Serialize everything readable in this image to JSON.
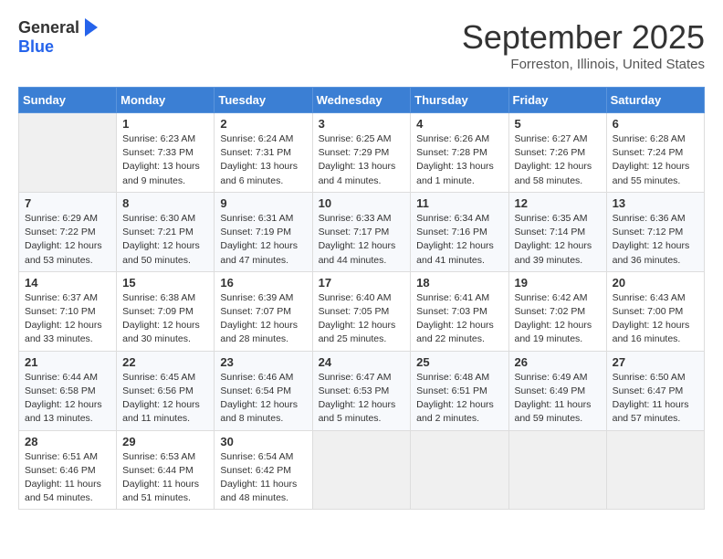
{
  "header": {
    "logo_general": "General",
    "logo_blue": "Blue",
    "month_title": "September 2025",
    "location": "Forreston, Illinois, United States"
  },
  "days_of_week": [
    "Sunday",
    "Monday",
    "Tuesday",
    "Wednesday",
    "Thursday",
    "Friday",
    "Saturday"
  ],
  "weeks": [
    [
      {
        "day": "",
        "info": ""
      },
      {
        "day": "1",
        "info": "Sunrise: 6:23 AM\nSunset: 7:33 PM\nDaylight: 13 hours\nand 9 minutes."
      },
      {
        "day": "2",
        "info": "Sunrise: 6:24 AM\nSunset: 7:31 PM\nDaylight: 13 hours\nand 6 minutes."
      },
      {
        "day": "3",
        "info": "Sunrise: 6:25 AM\nSunset: 7:29 PM\nDaylight: 13 hours\nand 4 minutes."
      },
      {
        "day": "4",
        "info": "Sunrise: 6:26 AM\nSunset: 7:28 PM\nDaylight: 13 hours\nand 1 minute."
      },
      {
        "day": "5",
        "info": "Sunrise: 6:27 AM\nSunset: 7:26 PM\nDaylight: 12 hours\nand 58 minutes."
      },
      {
        "day": "6",
        "info": "Sunrise: 6:28 AM\nSunset: 7:24 PM\nDaylight: 12 hours\nand 55 minutes."
      }
    ],
    [
      {
        "day": "7",
        "info": "Sunrise: 6:29 AM\nSunset: 7:22 PM\nDaylight: 12 hours\nand 53 minutes."
      },
      {
        "day": "8",
        "info": "Sunrise: 6:30 AM\nSunset: 7:21 PM\nDaylight: 12 hours\nand 50 minutes."
      },
      {
        "day": "9",
        "info": "Sunrise: 6:31 AM\nSunset: 7:19 PM\nDaylight: 12 hours\nand 47 minutes."
      },
      {
        "day": "10",
        "info": "Sunrise: 6:33 AM\nSunset: 7:17 PM\nDaylight: 12 hours\nand 44 minutes."
      },
      {
        "day": "11",
        "info": "Sunrise: 6:34 AM\nSunset: 7:16 PM\nDaylight: 12 hours\nand 41 minutes."
      },
      {
        "day": "12",
        "info": "Sunrise: 6:35 AM\nSunset: 7:14 PM\nDaylight: 12 hours\nand 39 minutes."
      },
      {
        "day": "13",
        "info": "Sunrise: 6:36 AM\nSunset: 7:12 PM\nDaylight: 12 hours\nand 36 minutes."
      }
    ],
    [
      {
        "day": "14",
        "info": "Sunrise: 6:37 AM\nSunset: 7:10 PM\nDaylight: 12 hours\nand 33 minutes."
      },
      {
        "day": "15",
        "info": "Sunrise: 6:38 AM\nSunset: 7:09 PM\nDaylight: 12 hours\nand 30 minutes."
      },
      {
        "day": "16",
        "info": "Sunrise: 6:39 AM\nSunset: 7:07 PM\nDaylight: 12 hours\nand 28 minutes."
      },
      {
        "day": "17",
        "info": "Sunrise: 6:40 AM\nSunset: 7:05 PM\nDaylight: 12 hours\nand 25 minutes."
      },
      {
        "day": "18",
        "info": "Sunrise: 6:41 AM\nSunset: 7:03 PM\nDaylight: 12 hours\nand 22 minutes."
      },
      {
        "day": "19",
        "info": "Sunrise: 6:42 AM\nSunset: 7:02 PM\nDaylight: 12 hours\nand 19 minutes."
      },
      {
        "day": "20",
        "info": "Sunrise: 6:43 AM\nSunset: 7:00 PM\nDaylight: 12 hours\nand 16 minutes."
      }
    ],
    [
      {
        "day": "21",
        "info": "Sunrise: 6:44 AM\nSunset: 6:58 PM\nDaylight: 12 hours\nand 13 minutes."
      },
      {
        "day": "22",
        "info": "Sunrise: 6:45 AM\nSunset: 6:56 PM\nDaylight: 12 hours\nand 11 minutes."
      },
      {
        "day": "23",
        "info": "Sunrise: 6:46 AM\nSunset: 6:54 PM\nDaylight: 12 hours\nand 8 minutes."
      },
      {
        "day": "24",
        "info": "Sunrise: 6:47 AM\nSunset: 6:53 PM\nDaylight: 12 hours\nand 5 minutes."
      },
      {
        "day": "25",
        "info": "Sunrise: 6:48 AM\nSunset: 6:51 PM\nDaylight: 12 hours\nand 2 minutes."
      },
      {
        "day": "26",
        "info": "Sunrise: 6:49 AM\nSunset: 6:49 PM\nDaylight: 11 hours\nand 59 minutes."
      },
      {
        "day": "27",
        "info": "Sunrise: 6:50 AM\nSunset: 6:47 PM\nDaylight: 11 hours\nand 57 minutes."
      }
    ],
    [
      {
        "day": "28",
        "info": "Sunrise: 6:51 AM\nSunset: 6:46 PM\nDaylight: 11 hours\nand 54 minutes."
      },
      {
        "day": "29",
        "info": "Sunrise: 6:53 AM\nSunset: 6:44 PM\nDaylight: 11 hours\nand 51 minutes."
      },
      {
        "day": "30",
        "info": "Sunrise: 6:54 AM\nSunset: 6:42 PM\nDaylight: 11 hours\nand 48 minutes."
      },
      {
        "day": "",
        "info": ""
      },
      {
        "day": "",
        "info": ""
      },
      {
        "day": "",
        "info": ""
      },
      {
        "day": "",
        "info": ""
      }
    ]
  ]
}
